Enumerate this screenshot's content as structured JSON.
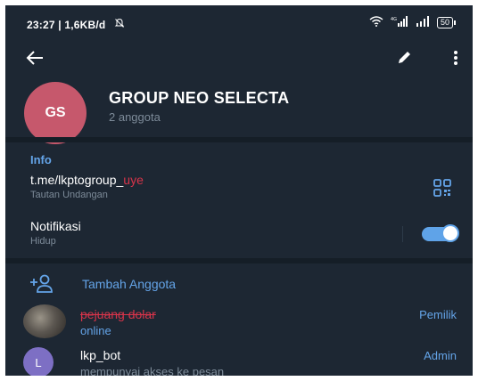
{
  "status_bar": {
    "time_info": "23:27 | 1,6KB/d",
    "network_label": "4G",
    "battery": "50"
  },
  "header": {
    "avatar_initials": "GS",
    "title": "GROUP NEO SELECTA",
    "subtitle": "2 anggota"
  },
  "info": {
    "section_label": "Info",
    "invite_link_prefix": "t.me/lkptogroup_",
    "invite_link_redacted": "uye",
    "invite_link_caption": "Tautan Undangan",
    "notifications_label": "Notifikasi",
    "notifications_state": "Hidup",
    "notifications_on": true
  },
  "members": {
    "add_label": "Tambah Anggota",
    "list": [
      {
        "name": "pejuang dolar",
        "status": "online",
        "role": "Pemilik"
      },
      {
        "name": "lkp_bot",
        "status": "mempunyai akses ke pesan",
        "role": "Admin",
        "initial": "L"
      }
    ]
  },
  "colors": {
    "background": "#1d2733",
    "accent": "#64a4e8",
    "group_avatar": "#c6586c",
    "bot_avatar": "#7d6fc4"
  }
}
